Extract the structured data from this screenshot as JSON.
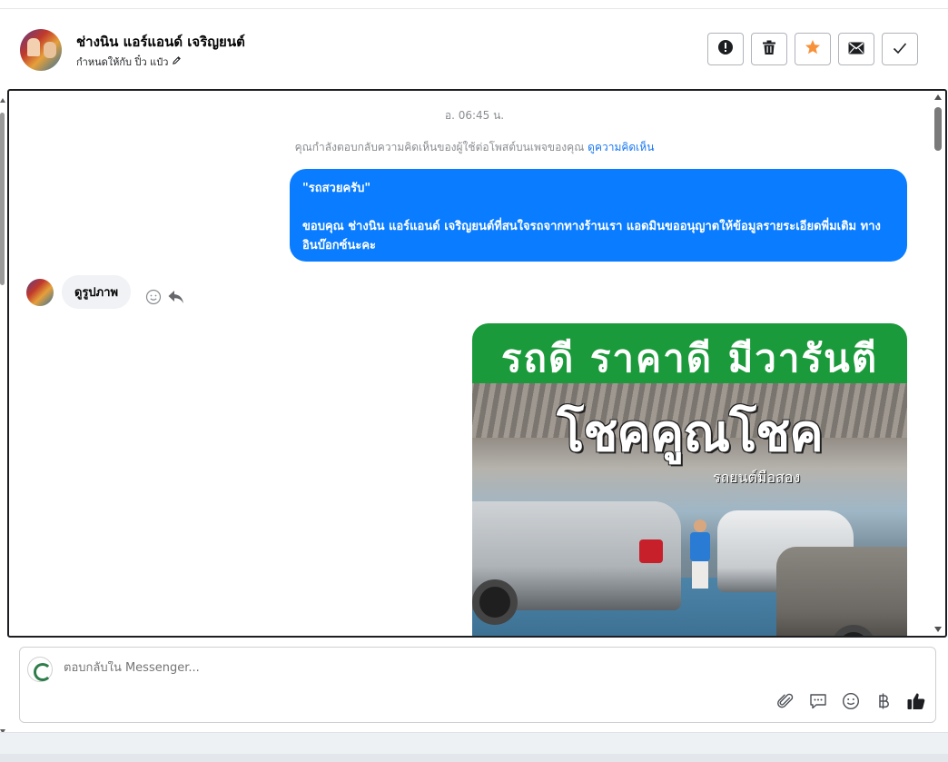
{
  "header": {
    "contact_name": "ช่างนิน แอร์แอนด์ เจริญยนต์",
    "assigned_text": "กำหนดให้กับ ปิ๋ว แป๋ว",
    "toolbar": [
      {
        "name": "spam-button",
        "icon": "alert-icon"
      },
      {
        "name": "delete-button",
        "icon": "trash-icon"
      },
      {
        "name": "star-button",
        "icon": "star-icon",
        "color": "#f7923b"
      },
      {
        "name": "mark-unread-button",
        "icon": "envelope-icon"
      },
      {
        "name": "mark-done-button",
        "icon": "check-icon"
      }
    ]
  },
  "chat": {
    "timestamp": "อ. 06:45 น.",
    "notice_text": "คุณกำลังตอบกลับความคิดเห็นของผู้ใช้ต่อโพสต์บนเพจของคุณ",
    "notice_link": "ดูความคิดเห็น",
    "outgoing": {
      "quote": "\"รถสวยครับ\"",
      "body": "ขอบคุณ ช่างนิน แอร์แอนด์ เจริญยนต์ที่สนใจรถจากทางร้านเรา แอดมินขออนุญาตให้ข้อมูลรายระเอียดพี่มเติม ทางอินบ๊อกซ์นะคะ",
      "color": "#0a7cff"
    },
    "incoming": {
      "text": "ดูรูปภาพ"
    },
    "image": {
      "banner_text": "รถดี ราคาดี มีวารันตี",
      "logo_text": "โชคคูณโชค",
      "logo_sub": "รถยนต์มือสอง"
    }
  },
  "composer": {
    "placeholder": "ตอบกลับใน Messenger...",
    "tools": [
      "attach-icon",
      "saved-reply-icon",
      "emoji-icon",
      "baht-icon",
      "like-icon"
    ]
  }
}
